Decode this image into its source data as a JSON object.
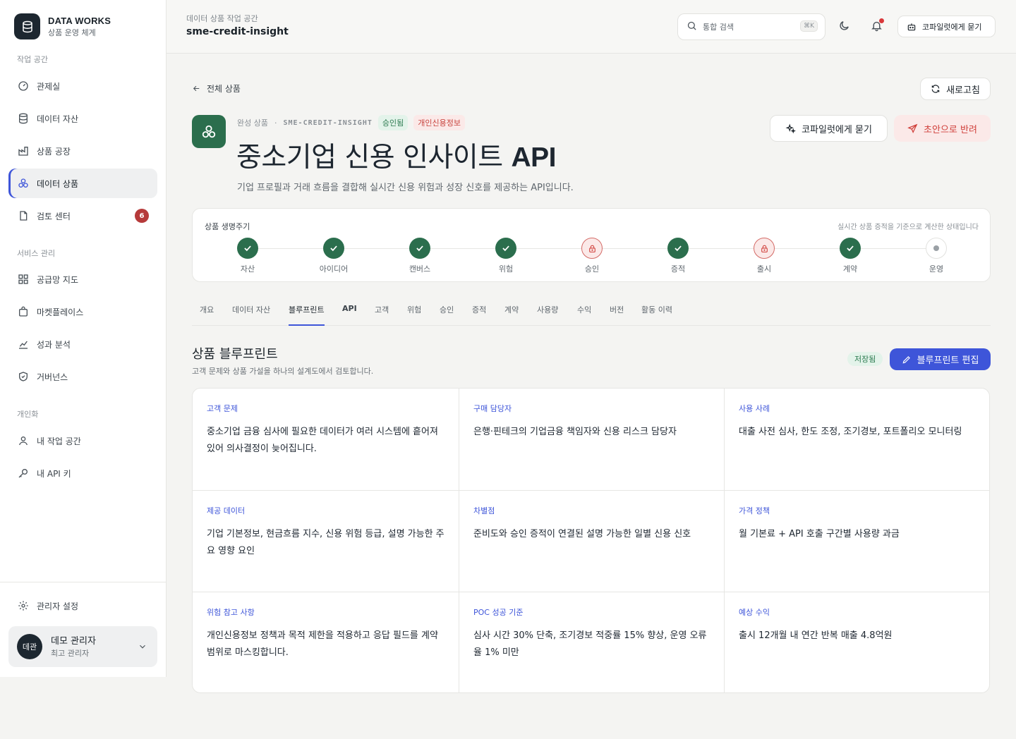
{
  "brand": {
    "name": "DATA WORKS",
    "subtitle": "상품 운영 체계"
  },
  "sidebar": {
    "sections": [
      {
        "label": "작업 공간"
      },
      {
        "label": "서비스 관리"
      },
      {
        "label": "개인화"
      }
    ],
    "items": [
      {
        "label": "관제실",
        "icon": "gauge-icon"
      },
      {
        "label": "데이터 자산",
        "icon": "database-icon"
      },
      {
        "label": "상품 공장",
        "icon": "factory-icon"
      },
      {
        "label": "데이터 상품",
        "icon": "product-icon",
        "active": true
      },
      {
        "label": "검토 센터",
        "icon": "document-icon",
        "badge": "6"
      },
      {
        "label": "공급망 지도",
        "icon": "grid-icon"
      },
      {
        "label": "마켓플레이스",
        "icon": "bag-icon"
      },
      {
        "label": "성과 분석",
        "icon": "chart-icon"
      },
      {
        "label": "거버넌스",
        "icon": "shield-icon"
      },
      {
        "label": "내 작업 공간",
        "icon": "user-icon"
      },
      {
        "label": "내 API 키",
        "icon": "key-icon"
      }
    ],
    "settings_label": "관리자 설정",
    "user": {
      "avatar": "데관",
      "name": "데모 관리자",
      "role": "최고 관리자"
    }
  },
  "topbar": {
    "breadcrumb": "데이터 상품 작업 공간",
    "title": "sme-credit-insight",
    "search_placeholder": "통합 검색",
    "search_shortcut": "⌘K",
    "copilot_label": "코파일럿에게 묻기"
  },
  "main": {
    "back_label": "전체 상품",
    "refresh_label": "새로고침",
    "product": {
      "category": "완성 상품",
      "code": "SME-CREDIT-INSIGHT",
      "status_badge": "승인됨",
      "data_badge": "개인신용정보",
      "title_prefix": "중소기업 신용 인사이트 ",
      "title_suffix": "API",
      "description": "기업 프로필과 거래 흐름을 결합해 실시간 신용 위험과 성장 신호를 제공하는 API입니다."
    },
    "ask_copilot_label": "코파일럿에게 묻기",
    "return_draft_label": "초안으로 반려",
    "lifecycle": {
      "label": "상품 생명주기",
      "note": "실시간 상품 증적을 기준으로 계산한 상태입니다",
      "steps": [
        {
          "label": "자산",
          "state": "done"
        },
        {
          "label": "아이디어",
          "state": "done"
        },
        {
          "label": "캔버스",
          "state": "done"
        },
        {
          "label": "위험",
          "state": "done"
        },
        {
          "label": "승인",
          "state": "locked"
        },
        {
          "label": "증적",
          "state": "done"
        },
        {
          "label": "출시",
          "state": "locked"
        },
        {
          "label": "계약",
          "state": "done"
        },
        {
          "label": "운영",
          "state": "pending"
        }
      ]
    },
    "tabs": [
      {
        "label": "개요"
      },
      {
        "label": "데이터 자산"
      },
      {
        "label": "블루프린트",
        "active": true
      },
      {
        "label": "API"
      },
      {
        "label": "고객"
      },
      {
        "label": "위험"
      },
      {
        "label": "승인"
      },
      {
        "label": "증적"
      },
      {
        "label": "계약"
      },
      {
        "label": "사용량"
      },
      {
        "label": "수익"
      },
      {
        "label": "버전"
      },
      {
        "label": "활동 이력"
      }
    ],
    "blueprint": {
      "title": "상품 블루프린트",
      "subtitle": "고객 문제와 상품 가설을 하나의 설계도에서 검토합니다.",
      "saved_label": "저장됨",
      "edit_label": "블루프린트 편집",
      "cells": [
        {
          "label": "고객 문제",
          "text": "중소기업 금융 심사에 필요한 데이터가 여러 시스템에 흩어져 있어 의사결정이 늦어집니다."
        },
        {
          "label": "구매 담당자",
          "text": "은행·핀테크의 기업금융 책임자와 신용 리스크 담당자"
        },
        {
          "label": "사용 사례",
          "text": "대출 사전 심사, 한도 조정, 조기경보, 포트폴리오 모니터링"
        },
        {
          "label": "제공 데이터",
          "text": "기업 기본정보, 현금흐름 지수, 신용 위험 등급, 설명 가능한 주요 영향 요인"
        },
        {
          "label": "차별점",
          "text": "준비도와 승인 증적이 연결된 설명 가능한 일별 신용 신호"
        },
        {
          "label": "가격 정책",
          "text": "월 기본료 + API 호출 구간별 사용량 과금"
        },
        {
          "label": "위험 참고 사항",
          "text": "개인신용정보 정책과 목적 제한을 적용하고 응답 필드를 계약 범위로 마스킹합니다."
        },
        {
          "label": "POC 성공 기준",
          "text": "심사 시간 30% 단축, 조기경보 적중률 15% 향상, 운영 오류율 1% 미만"
        },
        {
          "label": "예상 수익",
          "text": "출시 12개월 내 연간 반복 매출 4.8억원"
        }
      ]
    }
  },
  "colors": {
    "accent": "#3e55d9",
    "success": "#2b6e4d",
    "danger": "#d03f3a"
  }
}
